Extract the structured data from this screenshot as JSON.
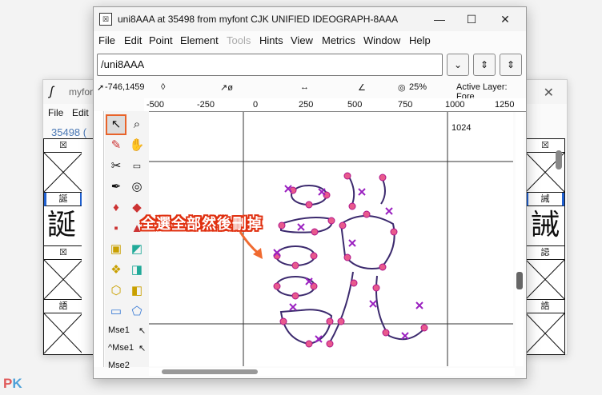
{
  "background_window": {
    "title": "myfont",
    "menu": [
      "File",
      "Edit"
    ],
    "cursor_info": "35498 (",
    "close": "✕",
    "cells": [
      {
        "label": "☒",
        "glyph": ""
      },
      {
        "label": "誕",
        "glyph": "誕"
      },
      {
        "label": "☒",
        "glyph": ""
      },
      {
        "label": "語",
        "glyph": ""
      },
      {
        "label": "☒",
        "glyph": ""
      },
      {
        "label": "誡",
        "glyph": "誡"
      },
      {
        "label": "誋",
        "glyph": ""
      },
      {
        "label": "誥",
        "glyph": ""
      }
    ]
  },
  "main_window": {
    "title": "uni8AAA at 35498 from myfont CJK UNIFIED IDEOGRAPH-8AAA",
    "buttons": {
      "minimize": "—",
      "maximize": "☐",
      "close": "✕"
    },
    "menu": [
      {
        "label": "File",
        "disabled": false
      },
      {
        "label": "Edit",
        "disabled": false
      },
      {
        "label": "Point",
        "disabled": false
      },
      {
        "label": "Element",
        "disabled": false
      },
      {
        "label": "Tools",
        "disabled": true
      },
      {
        "label": "Hints",
        "disabled": false
      },
      {
        "label": "View",
        "disabled": false
      },
      {
        "label": "Metrics",
        "disabled": false
      },
      {
        "label": "Window",
        "disabled": false
      },
      {
        "label": "Help",
        "disabled": false
      }
    ],
    "glyph_name": "/uni8AAA",
    "dropdown_glyph": "⌄",
    "prev_glyph": "⇕",
    "next_glyph": "⇕",
    "info": {
      "coords": "-746,1459",
      "zoom": "25%",
      "active_layer": "Active Layer: Fore"
    },
    "ruler_ticks": [
      "-500",
      "-250",
      "0",
      "250",
      "500",
      "750",
      "1000",
      "1250"
    ],
    "canvas_label": "1024",
    "mse_labels": [
      "Mse1",
      "^Mse1",
      "Mse2"
    ]
  },
  "annotation": {
    "text": "全選全部然後刪掉",
    "color": "#e03010"
  },
  "watermark": {
    "p": "P",
    "k": "K"
  }
}
